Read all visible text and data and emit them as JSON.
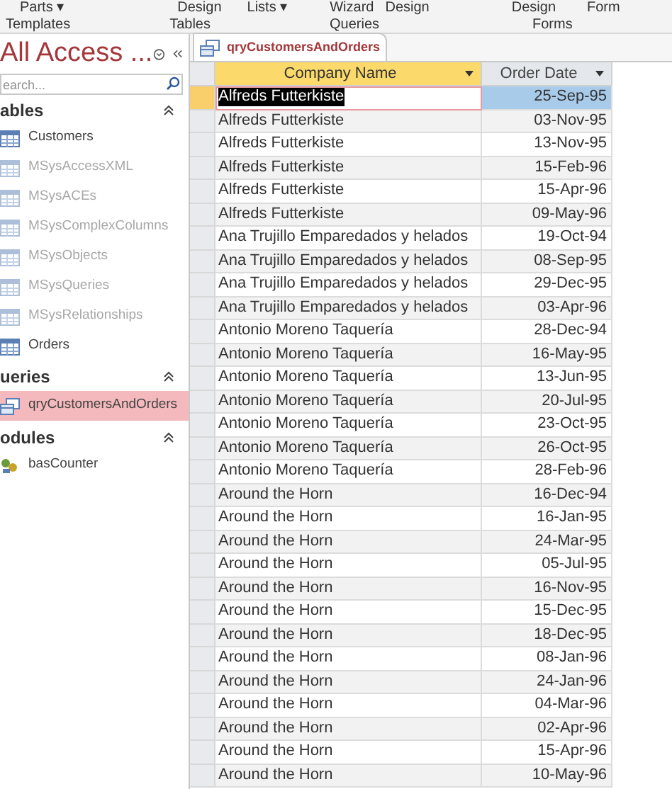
{
  "ribbon": {
    "buttons": [
      "Parts ▾",
      "Design",
      "Lists ▾",
      "Wizard",
      "Design",
      "Design",
      "Form"
    ],
    "groups": [
      "Templates",
      "Tables",
      "Queries",
      "Forms"
    ]
  },
  "nav_pane": {
    "title": "All Access ...",
    "search": {
      "placeholder": "earch..."
    },
    "sections": [
      {
        "title": "ables",
        "items": [
          {
            "label": "Customers",
            "kind": "table",
            "system": false,
            "selected": false
          },
          {
            "label": "MSysAccessXML",
            "kind": "table",
            "system": true,
            "selected": false
          },
          {
            "label": "MSysACEs",
            "kind": "table",
            "system": true,
            "selected": false
          },
          {
            "label": "MSysComplexColumns",
            "kind": "table",
            "system": true,
            "selected": false
          },
          {
            "label": "MSysObjects",
            "kind": "table",
            "system": true,
            "selected": false
          },
          {
            "label": "MSysQueries",
            "kind": "table",
            "system": true,
            "selected": false
          },
          {
            "label": "MSysRelationships",
            "kind": "table",
            "system": true,
            "selected": false
          },
          {
            "label": "Orders",
            "kind": "table",
            "system": false,
            "selected": false
          }
        ]
      },
      {
        "title": "ueries",
        "items": [
          {
            "label": "qryCustomersAndOrders",
            "kind": "query",
            "system": false,
            "selected": true
          }
        ]
      },
      {
        "title": "odules",
        "items": [
          {
            "label": "basCounter",
            "kind": "module",
            "system": false,
            "selected": false
          }
        ]
      }
    ]
  },
  "document_tab": {
    "title": "qryCustomersAndOrders"
  },
  "table": {
    "columns": [
      {
        "label": "Company Name",
        "selected": true
      },
      {
        "label": "Order Date",
        "selected": false
      }
    ],
    "rows": [
      {
        "cells": [
          "Alfreds Futterkiste",
          "25-Sep-95"
        ],
        "selected": true
      },
      {
        "cells": [
          "Alfreds Futterkiste",
          "03-Nov-95"
        ],
        "selected": false
      },
      {
        "cells": [
          "Alfreds Futterkiste",
          "13-Nov-95"
        ],
        "selected": false
      },
      {
        "cells": [
          "Alfreds Futterkiste",
          "15-Feb-96"
        ],
        "selected": false
      },
      {
        "cells": [
          "Alfreds Futterkiste",
          "15-Apr-96"
        ],
        "selected": false
      },
      {
        "cells": [
          "Alfreds Futterkiste",
          "09-May-96"
        ],
        "selected": false
      },
      {
        "cells": [
          "Ana Trujillo Emparedados y helados",
          "19-Oct-94"
        ],
        "selected": false
      },
      {
        "cells": [
          "Ana Trujillo Emparedados y helados",
          "08-Sep-95"
        ],
        "selected": false
      },
      {
        "cells": [
          "Ana Trujillo Emparedados y helados",
          "29-Dec-95"
        ],
        "selected": false
      },
      {
        "cells": [
          "Ana Trujillo Emparedados y helados",
          "03-Apr-96"
        ],
        "selected": false
      },
      {
        "cells": [
          "Antonio Moreno Taquería",
          "28-Dec-94"
        ],
        "selected": false
      },
      {
        "cells": [
          "Antonio Moreno Taquería",
          "16-May-95"
        ],
        "selected": false
      },
      {
        "cells": [
          "Antonio Moreno Taquería",
          "13-Jun-95"
        ],
        "selected": false
      },
      {
        "cells": [
          "Antonio Moreno Taquería",
          "20-Jul-95"
        ],
        "selected": false
      },
      {
        "cells": [
          "Antonio Moreno Taquería",
          "23-Oct-95"
        ],
        "selected": false
      },
      {
        "cells": [
          "Antonio Moreno Taquería",
          "26-Oct-95"
        ],
        "selected": false
      },
      {
        "cells": [
          "Antonio Moreno Taquería",
          "28-Feb-96"
        ],
        "selected": false
      },
      {
        "cells": [
          "Around the Horn",
          "16-Dec-94"
        ],
        "selected": false
      },
      {
        "cells": [
          "Around the Horn",
          "16-Jan-95"
        ],
        "selected": false
      },
      {
        "cells": [
          "Around the Horn",
          "24-Mar-95"
        ],
        "selected": false
      },
      {
        "cells": [
          "Around the Horn",
          "05-Jul-95"
        ],
        "selected": false
      },
      {
        "cells": [
          "Around the Horn",
          "16-Nov-95"
        ],
        "selected": false
      },
      {
        "cells": [
          "Around the Horn",
          "15-Dec-95"
        ],
        "selected": false
      },
      {
        "cells": [
          "Around the Horn",
          "18-Dec-95"
        ],
        "selected": false
      },
      {
        "cells": [
          "Around the Horn",
          "08-Jan-96"
        ],
        "selected": false
      },
      {
        "cells": [
          "Around the Horn",
          "24-Jan-96"
        ],
        "selected": false
      },
      {
        "cells": [
          "Around the Horn",
          "04-Mar-96"
        ],
        "selected": false
      },
      {
        "cells": [
          "Around the Horn",
          "02-Apr-96"
        ],
        "selected": false
      },
      {
        "cells": [
          "Around the Horn",
          "15-Apr-96"
        ],
        "selected": false
      },
      {
        "cells": [
          "Around the Horn",
          "10-May-96"
        ],
        "selected": false
      }
    ]
  }
}
